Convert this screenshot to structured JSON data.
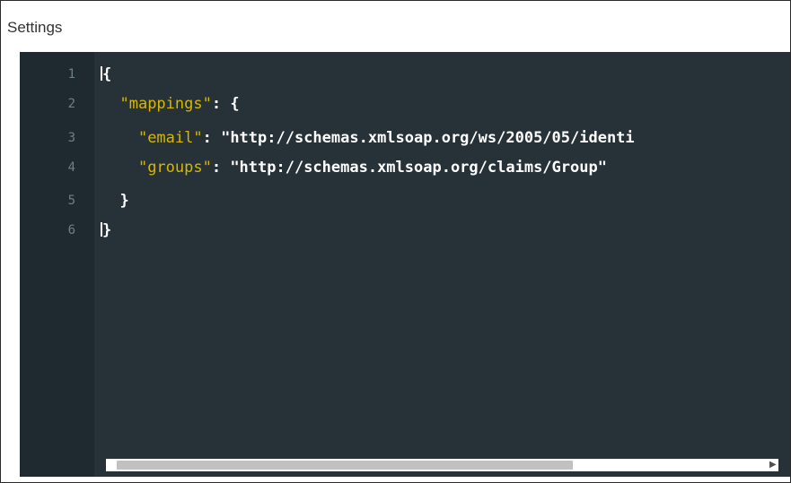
{
  "panel": {
    "title": "Settings"
  },
  "editor": {
    "lines": [
      {
        "num": "1",
        "text": "{"
      },
      {
        "num": "2",
        "indent": "  ",
        "key": "\"mappings\"",
        "rest": ": {"
      },
      {
        "num": "3",
        "indent": "    ",
        "key": "\"email\"",
        "rest": ": \"http://schemas.xmlsoap.org/ws/2005/05/identi"
      },
      {
        "num": "4",
        "indent": "    ",
        "key": "\"groups\"",
        "rest": ": \"http://schemas.xmlsoap.org/claims/Group\""
      },
      {
        "num": "5",
        "text": "  }"
      },
      {
        "num": "6",
        "text": "}"
      }
    ],
    "colors": {
      "background": "#263238",
      "gutter": "#1f2a30",
      "key": "#d7b700",
      "text": "#ffffff",
      "line_number": "#6e7f87"
    }
  },
  "scrollbar": {
    "left_arrow": "◀",
    "right_arrow": "▶"
  }
}
